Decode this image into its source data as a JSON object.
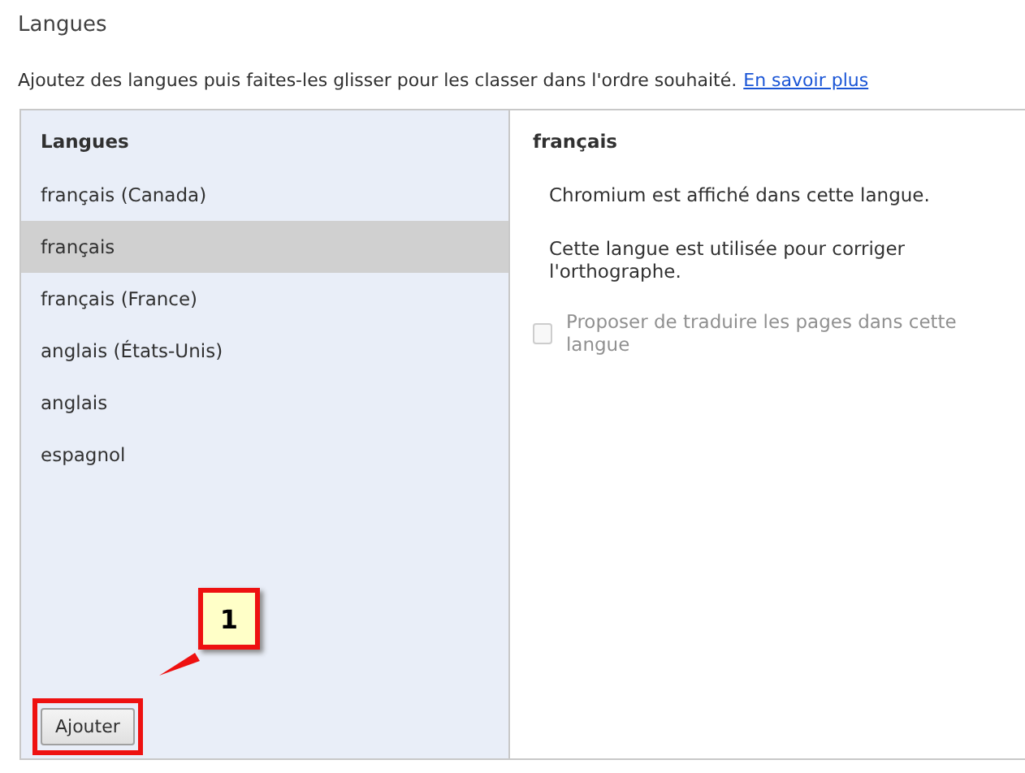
{
  "title": "Langues",
  "description": {
    "text": "Ajoutez des langues puis faites-les glisser pour les classer dans l'ordre souhaité.",
    "link": "En savoir plus"
  },
  "languages": {
    "header": "Langues",
    "items": [
      {
        "label": "français (Canada)",
        "selected": false
      },
      {
        "label": "français",
        "selected": true
      },
      {
        "label": "français (France)",
        "selected": false
      },
      {
        "label": "anglais (États-Unis)",
        "selected": false
      },
      {
        "label": "anglais",
        "selected": false
      },
      {
        "label": "espagnol",
        "selected": false
      }
    ],
    "add_button": "Ajouter"
  },
  "details": {
    "title": "français",
    "lines": [
      "Chromium est affiché dans cette langue.",
      "Cette langue est utilisée pour corriger l'orthographe."
    ],
    "translate": {
      "label": "Proposer de traduire les pages dans cette langue",
      "checked": false,
      "disabled": true
    }
  },
  "annotation": {
    "label": "1"
  }
}
